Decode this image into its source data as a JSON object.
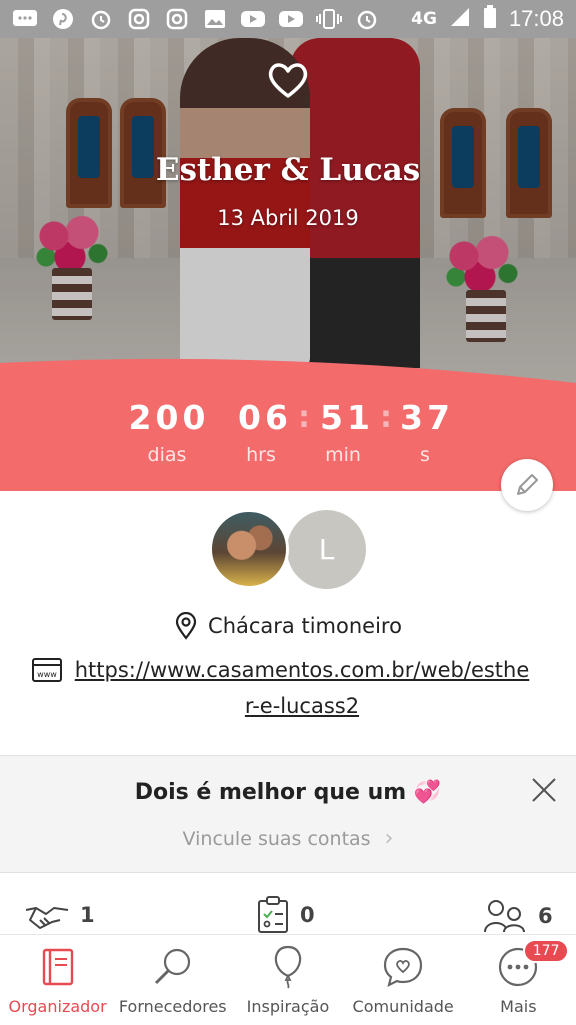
{
  "status_bar": {
    "network": "4G",
    "time": "17:08"
  },
  "hero": {
    "couple_name": "Esther & Lucas",
    "date": "13 Abril 2019"
  },
  "countdown": {
    "days": "200",
    "hours": "06",
    "minutes": "51",
    "seconds": "37",
    "days_label": "dias",
    "hours_label": "hrs",
    "minutes_label": "min",
    "seconds_label": "s",
    "band_color": "#f36b6b"
  },
  "profile": {
    "partner_initial": "L",
    "location": "Chácara timoneiro",
    "website": "https://www.casamentos.com.br/web/esther-e-lucass2"
  },
  "promo": {
    "title": "Dois é melhor que um",
    "emoji": "💞",
    "subtitle": "Vincule suas contas",
    "chevron": "›"
  },
  "stats": [
    {
      "icon": "handshake-icon",
      "value": "1"
    },
    {
      "icon": "checklist-icon",
      "value": "0"
    },
    {
      "icon": "guests-icon",
      "value": "6"
    }
  ],
  "bottom_nav": [
    {
      "label": "Organizador",
      "icon": "planner-icon",
      "active": true
    },
    {
      "label": "Fornecedores",
      "icon": "search-icon",
      "active": false
    },
    {
      "label": "Inspiração",
      "icon": "balloon-icon",
      "active": false
    },
    {
      "label": "Comunidade",
      "icon": "chat-heart-icon",
      "active": false
    },
    {
      "label": "Mais",
      "icon": "more-icon",
      "active": false,
      "badge": "177"
    }
  ],
  "colors": {
    "accent": "#e84a52",
    "countdown_band": "#f36b6b",
    "statusbar": "#9e9e9e"
  }
}
